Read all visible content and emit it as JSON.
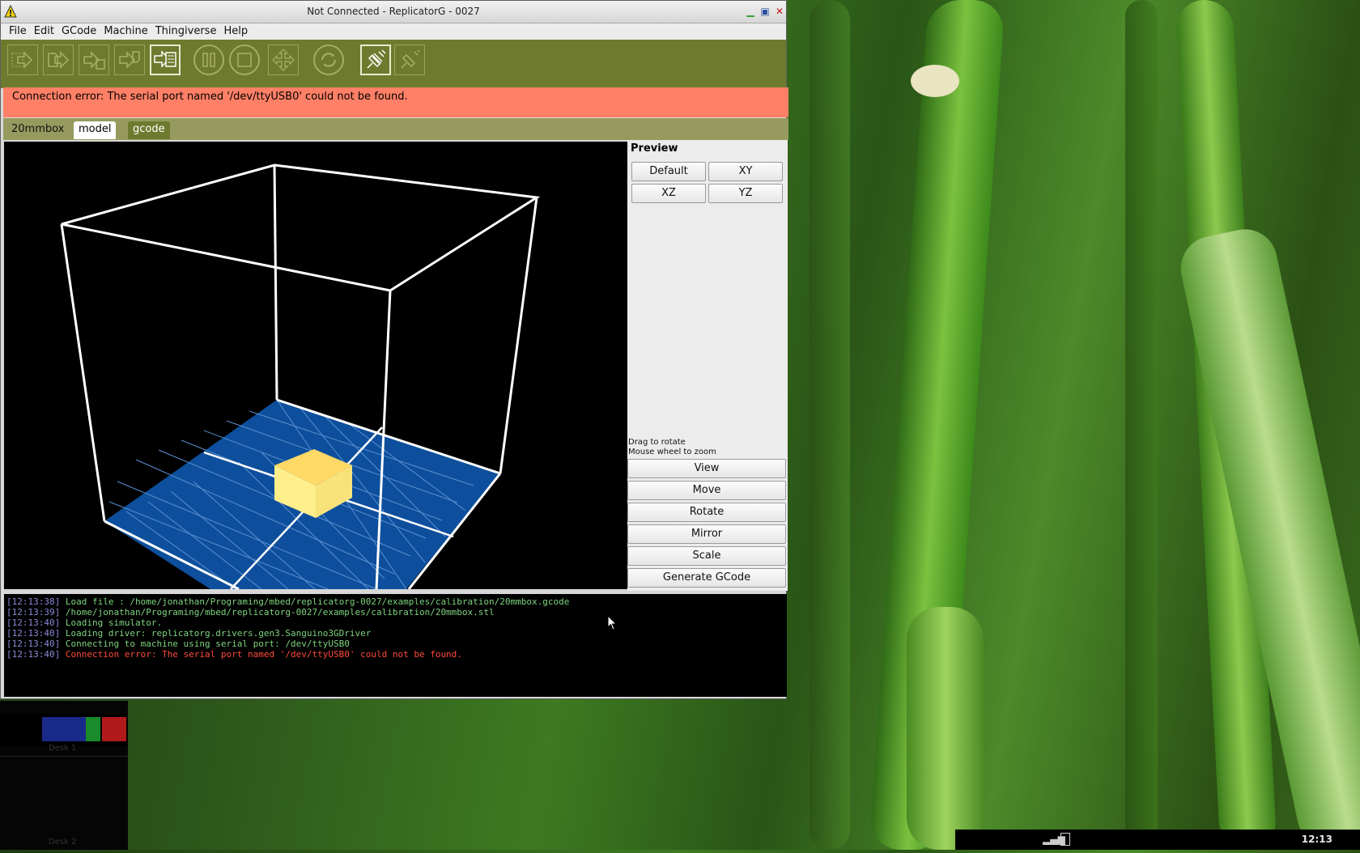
{
  "window": {
    "title": "Not Connected - ReplicatorG - 0027",
    "controls": [
      "minimize",
      "maximize",
      "close"
    ]
  },
  "menu": [
    "File",
    "Edit",
    "GCode",
    "Machine",
    "Thingiverse",
    "Help"
  ],
  "toolbar": {
    "buttons": [
      "build-from-file",
      "upload-to-sd",
      "build-to-file",
      "build-from-sd",
      "simulate",
      "pause",
      "stop",
      "control-panel",
      "reset",
      "connect",
      "disconnect"
    ]
  },
  "error_banner": "Connection error: The serial port named '/dev/ttyUSB0' could not be found.",
  "tabs": {
    "file_label": "20mmbox",
    "model": "model",
    "gcode": "gcode"
  },
  "preview": {
    "title": "Preview",
    "view_buttons": {
      "default": "Default",
      "xy": "XY",
      "xz": "XZ",
      "yz": "YZ"
    },
    "hint_rotate": "Drag to rotate",
    "hint_zoom": "Mouse wheel to zoom",
    "actions": {
      "view": "View",
      "move": "Move",
      "rotate": "Rotate",
      "mirror": "Mirror",
      "scale": "Scale",
      "generate": "Generate GCode"
    }
  },
  "console": [
    {
      "time": "[12:13:38]",
      "text": "Load file : /home/jonathan/Programing/mbed/replicatorg-0027/examples/calibration/20mmbox.gcode",
      "level": "info"
    },
    {
      "time": "[12:13:39]",
      "text": "/home/jonathan/Programing/mbed/replicatorg-0027/examples/calibration/20mmbox.stl",
      "level": "info"
    },
    {
      "time": "[12:13:40]",
      "text": "Loading simulator.",
      "level": "info"
    },
    {
      "time": "[12:13:40]",
      "text": "Loading driver: replicatorg.drivers.gen3.Sanguino3GDriver",
      "level": "info"
    },
    {
      "time": "[12:13:40]",
      "text": "Connecting to machine using serial port: /dev/ttyUSB0",
      "level": "info"
    },
    {
      "time": "[12:13:40]",
      "text": "Connection error: The serial port named '/dev/ttyUSB0' could not be found.",
      "level": "error"
    }
  ],
  "pager": {
    "desk1": "Desk 1",
    "desk2": "Desk 2"
  },
  "tray": {
    "clock": "12:13"
  },
  "colors": {
    "toolbar": "#6e7b2e",
    "error_banner": "#ff8066",
    "build_plate": "#0d4f9c",
    "model": "#ffe066",
    "log_text": "#7ed47e",
    "log_error": "#ff4a3a"
  }
}
